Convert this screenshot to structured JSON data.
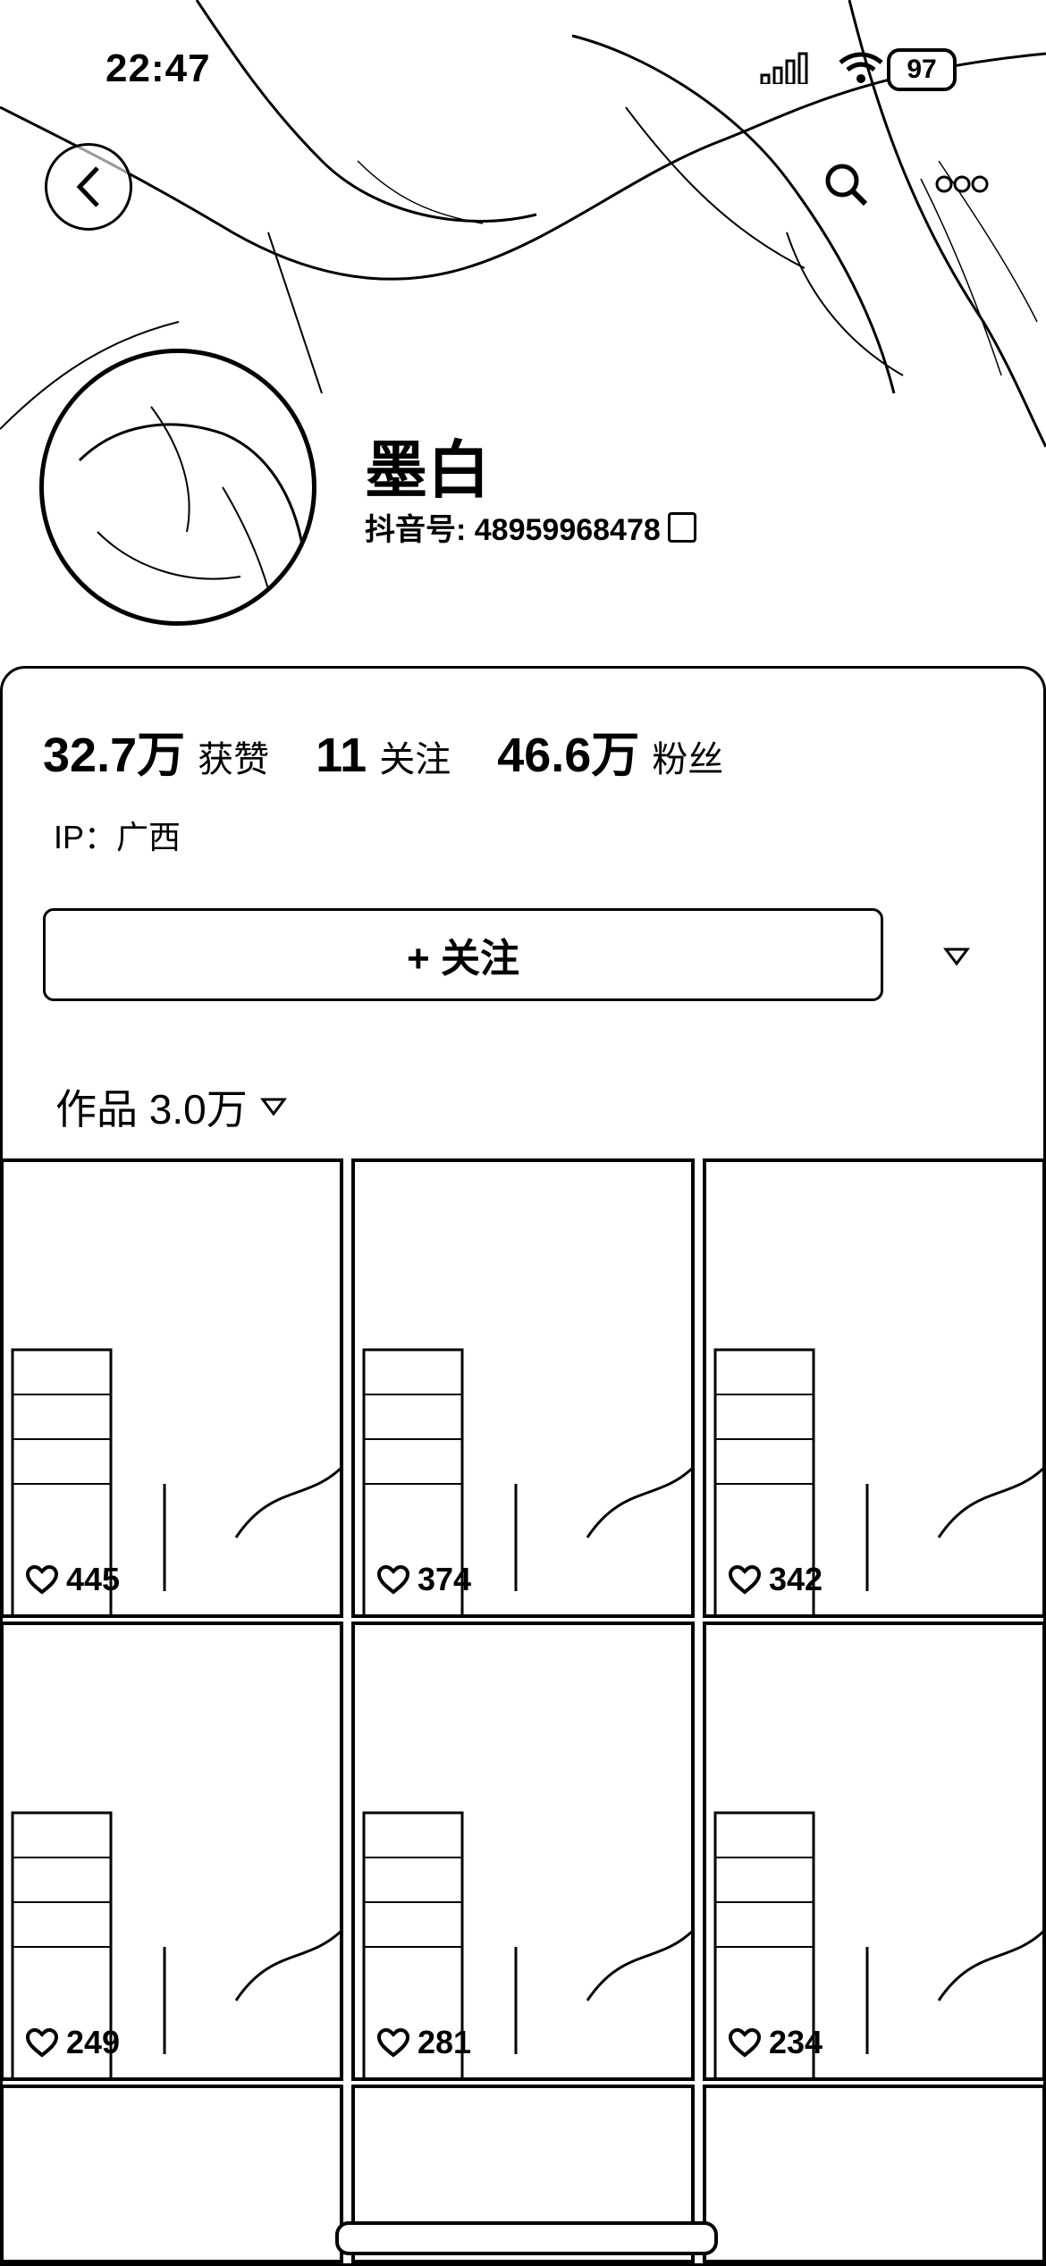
{
  "status_bar": {
    "time": "22:47",
    "battery": "97"
  },
  "header": {
    "back_icon": "chevron-left-icon",
    "search_icon": "search-icon",
    "more_icon": "more-dots-icon"
  },
  "profile": {
    "name": "墨白",
    "douyin_id": "抖音号: 48959968478"
  },
  "stats": [
    {
      "num": "32.7万",
      "label": "获赞"
    },
    {
      "num": "11",
      "label": "关注"
    },
    {
      "num": "46.6万",
      "label": "粉丝"
    }
  ],
  "ip": "IP：广西",
  "follow_button": "+ 关注",
  "works_label": "作品 3.0万",
  "videos": [
    {
      "likes": "445"
    },
    {
      "likes": "374"
    },
    {
      "likes": "342"
    },
    {
      "likes": "249"
    },
    {
      "likes": "281"
    },
    {
      "likes": "234"
    }
  ]
}
